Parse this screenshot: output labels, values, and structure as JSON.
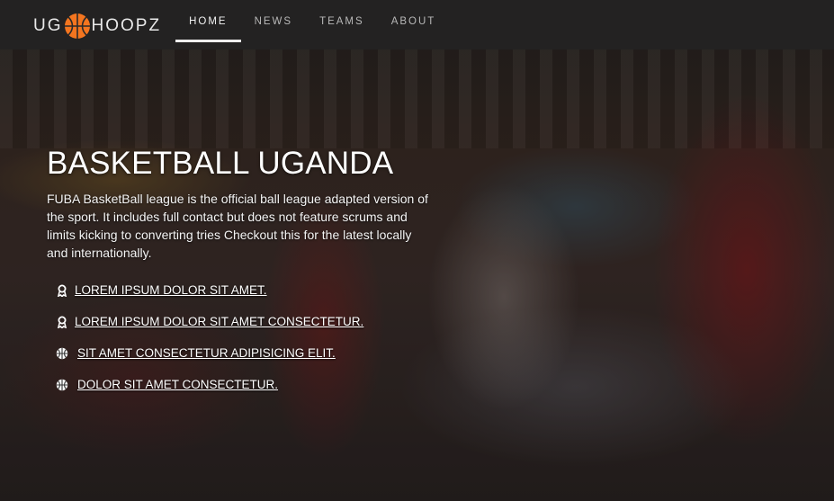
{
  "brand": {
    "prefix": "UG",
    "suffix": "HOOPZ"
  },
  "nav": [
    {
      "label": "HOME",
      "active": true
    },
    {
      "label": "NEWS",
      "active": false
    },
    {
      "label": "TEAMS",
      "active": false
    },
    {
      "label": "ABOUT",
      "active": false
    }
  ],
  "hero": {
    "title": "BASKETBALL UGANDA",
    "description": "FUBA BasketBall league is the official ball league adapted version of the sport. It includes full contact but does not feature scrums and limits kicking to converting tries Checkout this for the latest locally and internationally.",
    "links": [
      {
        "text": "LOREM IPSUM DOLOR SIT AMET.",
        "icon": "award-icon"
      },
      {
        "text": "LOREM IPSUM DOLOR SIT AMET CONSECTETUR.",
        "icon": "award-icon"
      },
      {
        "text": "SIT AMET CONSECTETUR ADIPISICING ELIT.",
        "icon": "basketball-icon"
      },
      {
        "text": "DOLOR SIT AMET CONSECTETUR.",
        "icon": "basketball-icon"
      }
    ]
  },
  "colors": {
    "accent": "#f4751f",
    "navbar": "#232323",
    "text": "#ffffff"
  }
}
